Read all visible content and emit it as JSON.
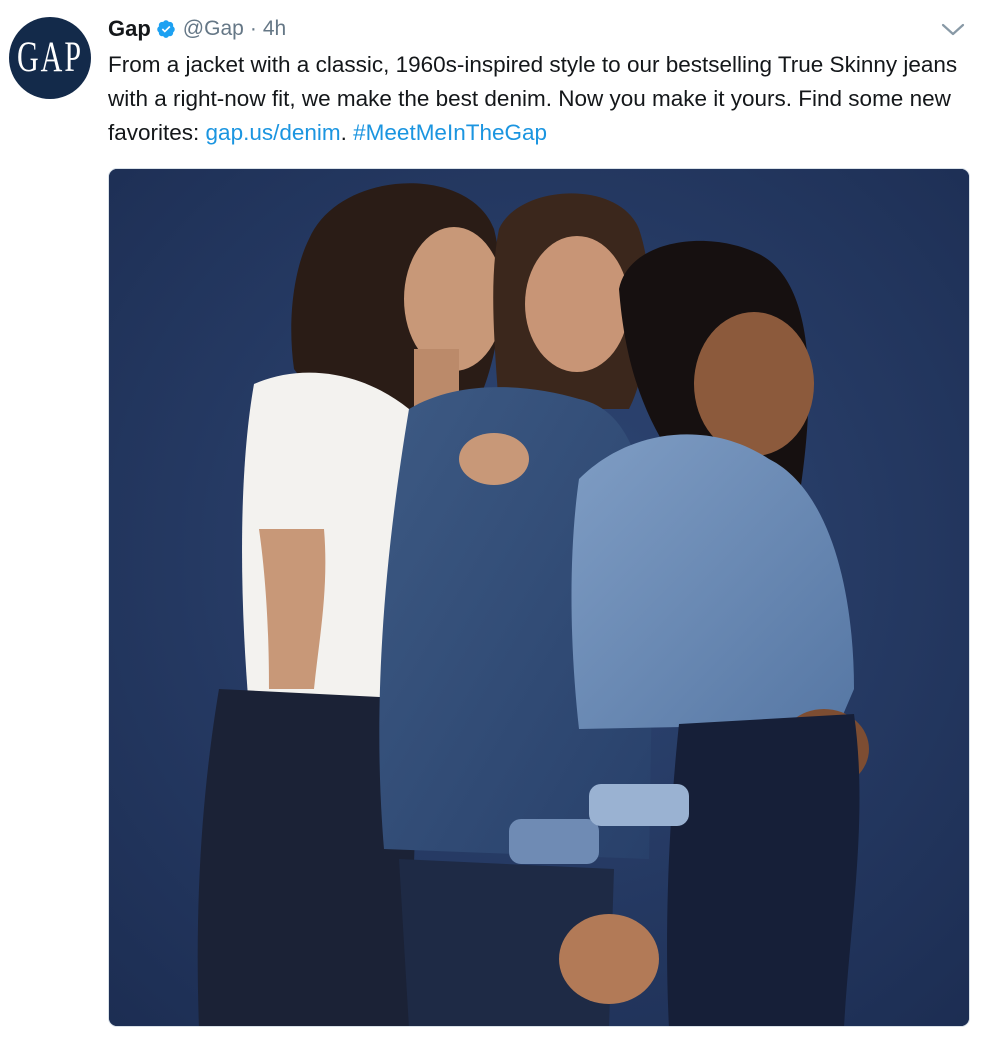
{
  "tweet": {
    "avatar_text": "GAP",
    "name": "Gap",
    "handle": "@Gap",
    "separator": "·",
    "time": "4h",
    "text_part1": "From a jacket with a classic, 1960s-inspired style to our bestselling True Skinny jeans with a right-now fit, we make the best denim. Now you make it yours. Find some new favorites: ",
    "link": "gap.us/denim",
    "text_part2": ". ",
    "hashtag": "#MeetMeInTheGap"
  },
  "icons": {
    "verified": "verified-badge-icon",
    "caret": "chevron-down-icon"
  },
  "colors": {
    "link": "#1b95e0",
    "verified": "#1da1f2",
    "muted": "#657786",
    "avatar_bg": "#132a4a"
  }
}
